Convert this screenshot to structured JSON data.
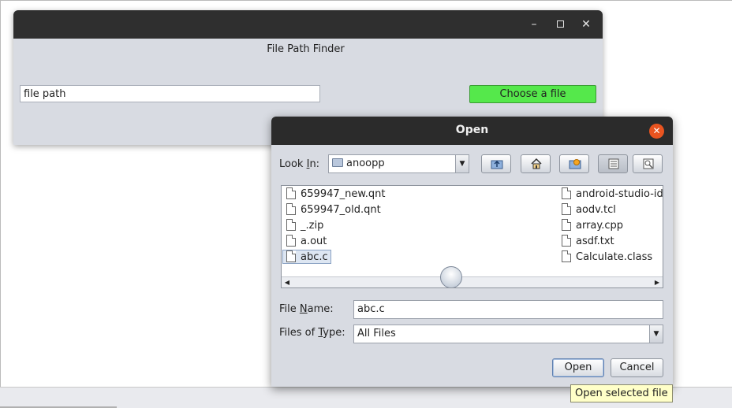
{
  "app": {
    "title_label": "File Path Finder",
    "path_field_value": "file path",
    "choose_button_label": "Choose a file",
    "choose_button_color": "#55e84b"
  },
  "dialog": {
    "title": "Open",
    "look_in_label_pre": "Look ",
    "look_in_label_key": "I",
    "look_in_label_post": "n:",
    "look_in_value": "anoopp",
    "toolbar_icons": [
      "up-folder-icon",
      "home-icon",
      "new-folder-icon",
      "list-view-icon",
      "details-view-icon"
    ],
    "files_col1": [
      "659947_new.qnt",
      "659947_old.qnt",
      "_.zip",
      "a.out",
      "abc.c"
    ],
    "files_col2": [
      "android-studio-ide",
      "aodv.tcl",
      "array.cpp",
      "asdf.txt",
      "Calculate.class"
    ],
    "file_name_label_pre": "File ",
    "file_name_label_key": "N",
    "file_name_label_post": "ame:",
    "file_name_value": "abc.c",
    "files_of_type_label_pre": "Files of ",
    "files_of_type_label_key": "T",
    "files_of_type_label_post": "ype:",
    "files_of_type_value": "All Files",
    "open_button": "Open",
    "cancel_button": "Cancel",
    "tooltip": "Open selected file",
    "close_button_color": "#e95420"
  }
}
